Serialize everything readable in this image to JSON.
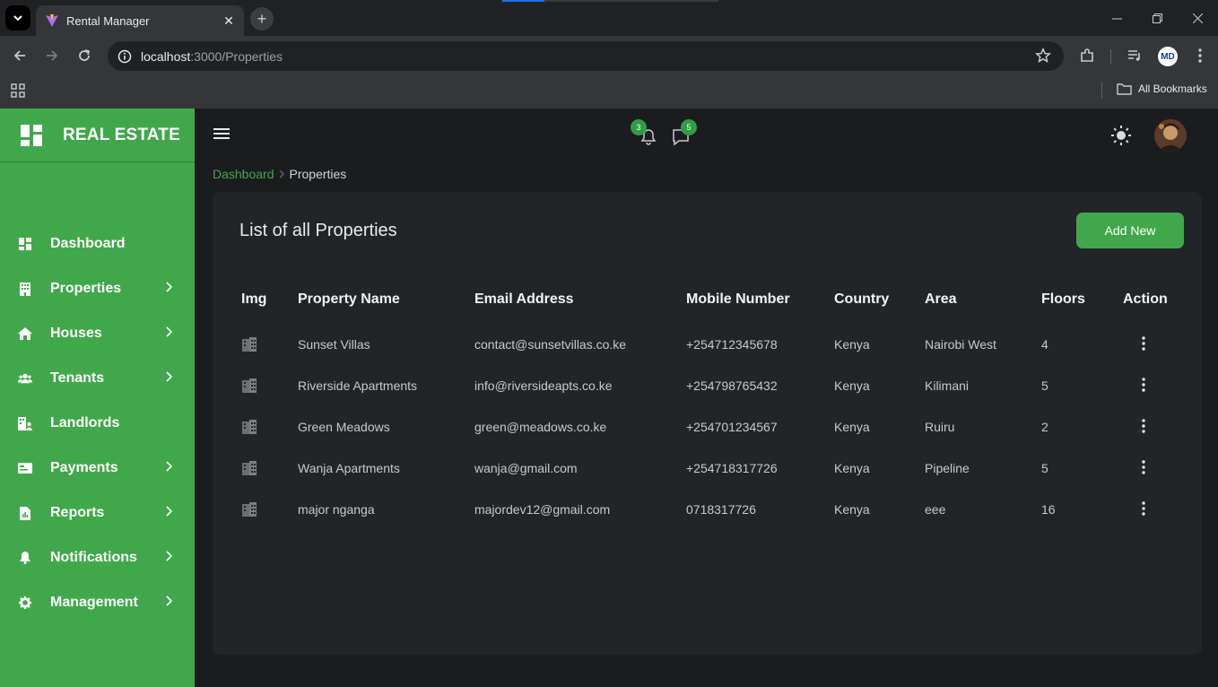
{
  "browser": {
    "tab_title": "Rental Manager",
    "url_host": "localhost",
    "url_path": ":3000/Properties",
    "bookmarks_label": "All Bookmarks",
    "profile_initials": "MD"
  },
  "sidebar": {
    "brand": "REAL ESTATE",
    "items": [
      {
        "label": "Dashboard",
        "icon": "dashboard-icon",
        "has_submenu": false
      },
      {
        "label": "Properties",
        "icon": "building-icon",
        "has_submenu": true
      },
      {
        "label": "Houses",
        "icon": "home-icon",
        "has_submenu": true
      },
      {
        "label": "Tenants",
        "icon": "users-icon",
        "has_submenu": true
      },
      {
        "label": "Landlords",
        "icon": "landlord-icon",
        "has_submenu": false
      },
      {
        "label": "Payments",
        "icon": "payment-card-icon",
        "has_submenu": true
      },
      {
        "label": "Reports",
        "icon": "report-icon",
        "has_submenu": true
      },
      {
        "label": "Notifications",
        "icon": "bell-icon",
        "has_submenu": true
      },
      {
        "label": "Management",
        "icon": "gear-icon",
        "has_submenu": true
      }
    ]
  },
  "topbar": {
    "notifications_count": "3",
    "messages_count": "5"
  },
  "breadcrumb": {
    "root": "Dashboard",
    "current": "Properties"
  },
  "main": {
    "title": "List of all Properties",
    "add_button": "Add New",
    "columns": [
      "Img",
      "Property Name",
      "Email Address",
      "Mobile Number",
      "Country",
      "Area",
      "Floors",
      "Action"
    ],
    "rows": [
      {
        "name": "Sunset Villas",
        "email": "contact@sunsetvillas.co.ke",
        "mobile": "+254712345678",
        "country": "Kenya",
        "area": "Nairobi West",
        "floors": "4"
      },
      {
        "name": "Riverside Apartments",
        "email": "info@riversideapts.co.ke",
        "mobile": "+254798765432",
        "country": "Kenya",
        "area": "Kilimani",
        "floors": "5"
      },
      {
        "name": "Green Meadows",
        "email": "green@meadows.co.ke",
        "mobile": "+254701234567",
        "country": "Kenya",
        "area": "Ruiru",
        "floors": "2"
      },
      {
        "name": "Wanja Apartments",
        "email": "wanja@gmail.com",
        "mobile": "+254718317726",
        "country": "Kenya",
        "area": "Pipeline",
        "floors": "5"
      },
      {
        "name": "major nganga",
        "email": "majordev12@gmail.com",
        "mobile": "0718317726",
        "country": "Kenya",
        "area": "eee",
        "floors": "16"
      }
    ]
  },
  "colors": {
    "accent": "#40a84a",
    "background": "#1b1c1e",
    "card": "#222426"
  }
}
